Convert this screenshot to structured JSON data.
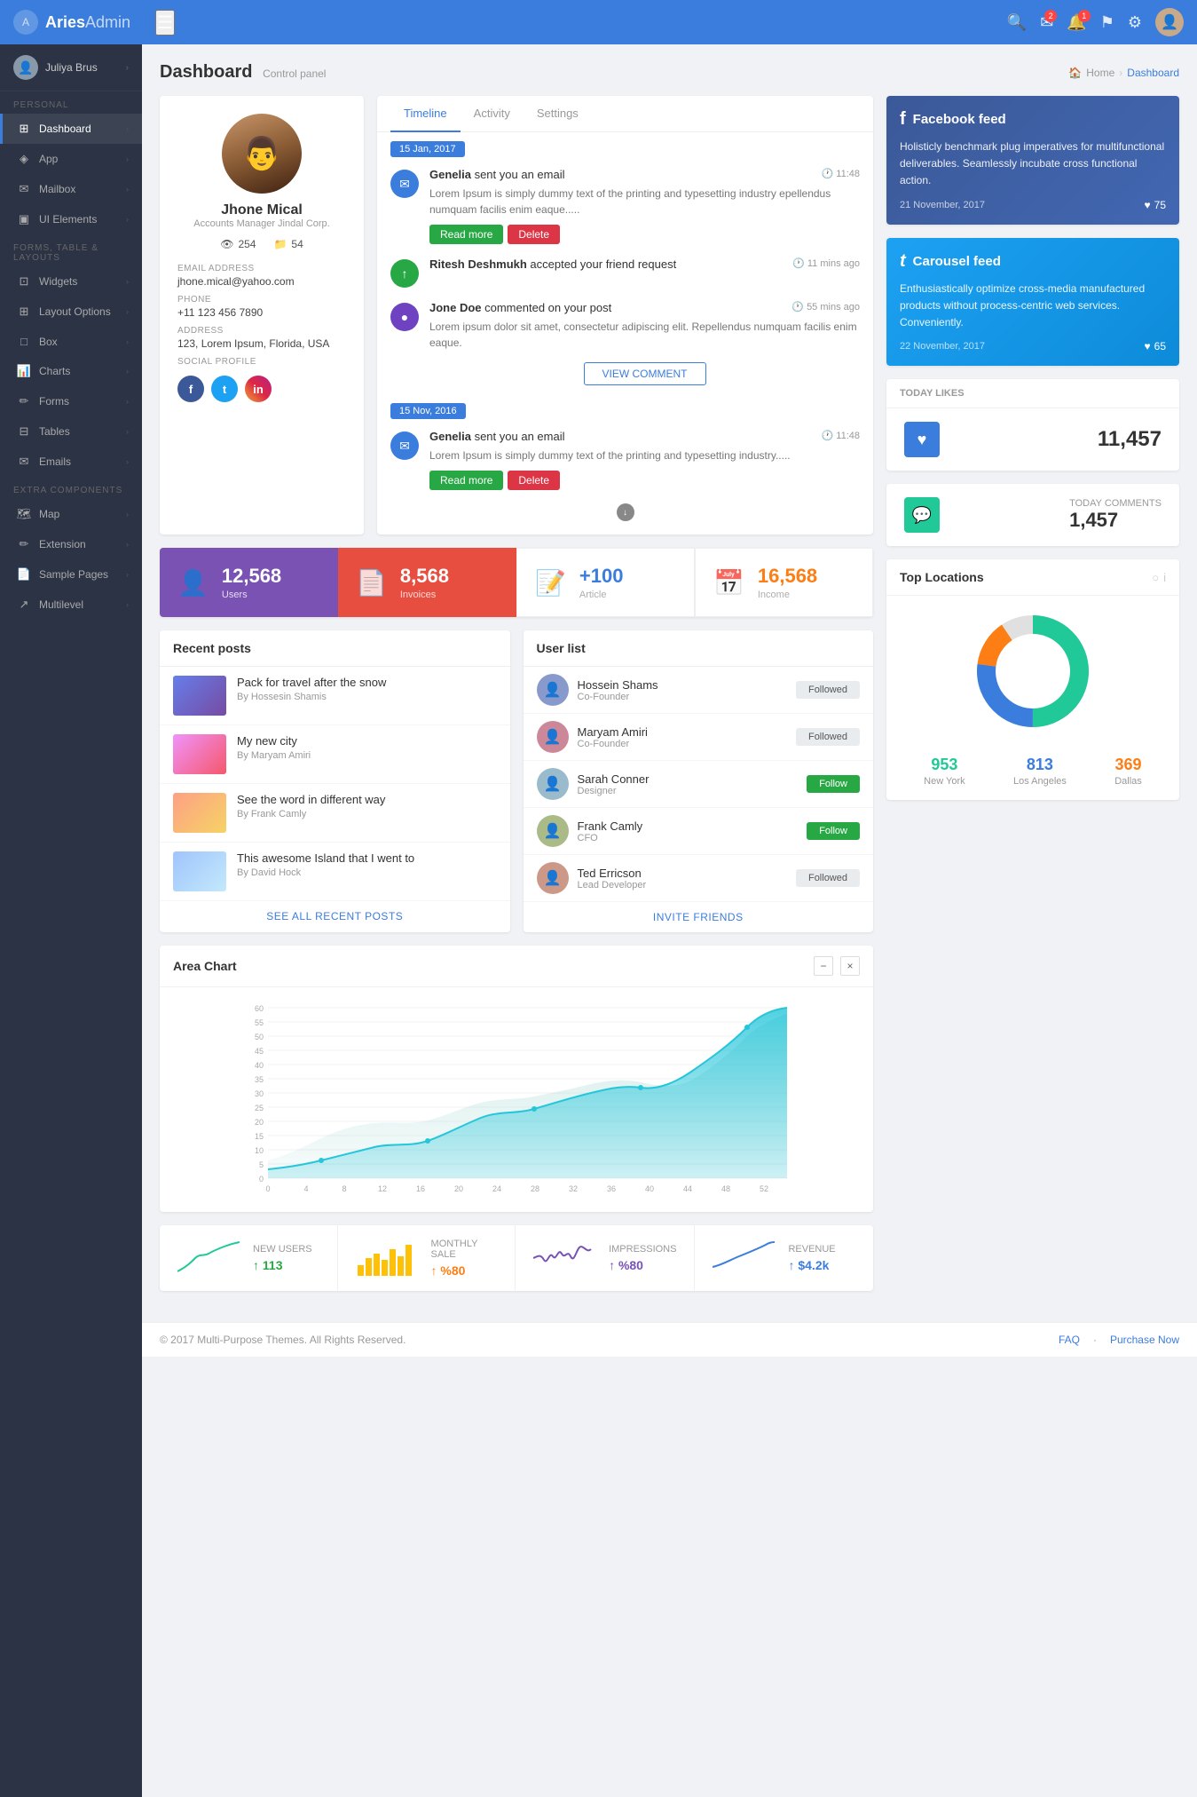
{
  "brand": {
    "logo": "A",
    "name_bold": "Aries",
    "name_light": "Admin"
  },
  "topnav": {
    "hamburger": "☰",
    "search_icon": "🔍",
    "email_icon": "✉",
    "bell_icon": "🔔",
    "flag_icon": "⚑",
    "settings_icon": "⚙",
    "email_badge": "2",
    "bell_badge": "1"
  },
  "sidebar": {
    "user": "Juliya Brus",
    "sections": [
      {
        "label": "PERSONAL",
        "items": [
          {
            "icon": "⊞",
            "label": "Dashboard",
            "active": true
          },
          {
            "icon": "◈",
            "label": "App"
          },
          {
            "icon": "✉",
            "label": "Mailbox"
          },
          {
            "icon": "▣",
            "label": "UI Elements"
          }
        ]
      },
      {
        "label": "FORMS, TABLE & LAYOUTS",
        "items": [
          {
            "icon": "⊡",
            "label": "Widgets"
          },
          {
            "icon": "⊞",
            "label": "Layout Options"
          },
          {
            "icon": "□",
            "label": "Box"
          },
          {
            "icon": "📊",
            "label": "Charts"
          },
          {
            "icon": "✏",
            "label": "Forms"
          },
          {
            "icon": "⊟",
            "label": "Tables"
          },
          {
            "icon": "✉",
            "label": "Emails"
          }
        ]
      },
      {
        "label": "EXTRA COMPONENTS",
        "items": [
          {
            "icon": "🗺",
            "label": "Map"
          },
          {
            "icon": "✏",
            "label": "Extension"
          },
          {
            "icon": "📄",
            "label": "Sample Pages"
          },
          {
            "icon": "↗",
            "label": "Multilevel"
          }
        ]
      }
    ]
  },
  "page": {
    "title": "Dashboard",
    "subtitle": "Control panel",
    "breadcrumb_home": "Home",
    "breadcrumb_current": "Dashboard"
  },
  "profile": {
    "name": "Jhone Mical",
    "role": "Accounts Manager Jindal Corp.",
    "views": "254",
    "files": "54",
    "email_label": "Email address",
    "email": "jhone.mical@yahoo.com",
    "phone_label": "Phone",
    "phone": "+11 123 456 7890",
    "address_label": "Address",
    "address": "123, Lorem Ipsum, Florida, USA",
    "social_label": "Social Profile"
  },
  "timeline": {
    "tabs": [
      "Timeline",
      "Activity",
      "Settings"
    ],
    "active_tab": "Timeline",
    "date1": "15 Jan, 2017",
    "date2": "15 Nov, 2016",
    "items": [
      {
        "icon": "✉",
        "color": "blue",
        "title_pre": "Genelia",
        "title_action": " sent you an email",
        "time": "11:48",
        "text": "Lorem Ipsum is simply dummy text of the printing and typesetting industry epellendus numquam facilis enim eaque.....",
        "actions": [
          "Read more",
          "Delete"
        ]
      },
      {
        "icon": "↑",
        "color": "green",
        "title_pre": "Ritesh Deshmukh",
        "title_action": " accepted your friend request",
        "time": "11 mins ago",
        "text": "",
        "actions": []
      },
      {
        "icon": "●",
        "color": "purple",
        "title_pre": "Jone Doe",
        "title_action": " commented on your post",
        "time": "55 mins ago",
        "text": "Lorem ipsum dolor sit amet, consectetur adipiscing elit. Repellendus numquam facilis enim eaque.",
        "actions": [
          "VIEW COMMENT"
        ]
      },
      {
        "icon": "✉",
        "color": "blue",
        "title_pre": "Genelia",
        "title_action": " sent you an email",
        "time": "11:48",
        "text": "Lorem Ipsum is simply dummy text of the printing and typesetting industry.....",
        "actions": [
          "Read more",
          "Delete"
        ]
      }
    ]
  },
  "fb_feed": {
    "icon": "f",
    "title": "Facebook feed",
    "text": "Holisticly benchmark plug imperatives for multifunctional deliverables. Seamlessly incubate cross functional action.",
    "date": "21 November, 2017",
    "likes": "75"
  },
  "tw_feed": {
    "icon": "t",
    "title": "Carousel feed",
    "text": "Enthusiastically optimize cross-media manufactured products without process-centric web services. Conveniently.",
    "date": "22 November, 2017",
    "likes": "65"
  },
  "today_likes": {
    "label": "TODAY LIKES",
    "value": "11,457"
  },
  "today_comments": {
    "label": "TODAY COMMENTS",
    "value": "1,457"
  },
  "stat_cards": [
    {
      "icon": "👤",
      "value": "12,568",
      "label": "Users",
      "style": "purple"
    },
    {
      "icon": "📄",
      "value": "8,568",
      "label": "Invoices",
      "style": "red"
    },
    {
      "icon": "📝",
      "value": "+100",
      "label": "Article",
      "style": "light"
    },
    {
      "icon": "📅",
      "value": "16,568",
      "label": "Income",
      "style": "light"
    }
  ],
  "recent_posts": {
    "title": "Recent posts",
    "posts": [
      {
        "title": "Pack for travel after the snow",
        "author": "By Hossesin Shamis",
        "thumb": "ocean"
      },
      {
        "title": "My new city",
        "author": "By Maryam Amiri",
        "thumb": "city"
      },
      {
        "title": "See the word in different way",
        "author": "By Frank Camly",
        "thumb": "sunset"
      },
      {
        "title": "This awesome Island that I went to",
        "author": "By David Hock",
        "thumb": "island"
      }
    ],
    "see_all": "SEE ALL RECENT POSTS"
  },
  "user_list": {
    "title": "User list",
    "users": [
      {
        "name": "Hossein Shams",
        "role": "Co-Founder",
        "btn": "Followed",
        "btn_style": "gray"
      },
      {
        "name": "Maryam Amiri",
        "role": "Co-Founder",
        "btn": "Followed",
        "btn_style": "gray"
      },
      {
        "name": "Sarah Conner",
        "role": "Designer",
        "btn": "Follow",
        "btn_style": "green"
      },
      {
        "name": "Frank Camly",
        "role": "CFO",
        "btn": "Follow",
        "btn_style": "green"
      },
      {
        "name": "Ted Erricson",
        "role": "Lead Developer",
        "btn": "Followed",
        "btn_style": "gray"
      }
    ],
    "invite": "INVITE FRIENDS"
  },
  "area_chart": {
    "title": "Area Chart",
    "y_labels": [
      "60",
      "55",
      "50",
      "45",
      "40",
      "35",
      "30",
      "25",
      "20",
      "15",
      "10",
      "5",
      "0"
    ],
    "x_labels": [
      "0",
      "4",
      "8",
      "12",
      "16",
      "20",
      "24",
      "28",
      "32",
      "36",
      "40",
      "44",
      "48",
      "52"
    ]
  },
  "top_locations": {
    "title": "Top Locations",
    "locations": [
      {
        "city": "New York",
        "count": "953",
        "color": "teal"
      },
      {
        "city": "Los Angeles",
        "count": "813",
        "color": "blue"
      },
      {
        "city": "Dallas",
        "count": "369",
        "color": "orange"
      }
    ]
  },
  "mini_stats": [
    {
      "label": "New Users",
      "value": "113",
      "trend": "↑",
      "trend_label": "113",
      "color": "teal"
    },
    {
      "label": "Monthly Sale",
      "value": "%80",
      "trend": "↑",
      "trend_label": "%80",
      "color": "orange"
    },
    {
      "label": "Impressions",
      "value": "%80",
      "trend": "↑",
      "trend_label": "%80",
      "color": "purple"
    },
    {
      "label": "Revenue",
      "value": "$4.2k",
      "trend": "↑",
      "trend_label": "4.2k",
      "color": "blue"
    }
  ],
  "footer": {
    "copy": "© 2017 Multi-Purpose Themes. All Rights Reserved.",
    "links": [
      "FAQ",
      "Purchase Now"
    ]
  }
}
